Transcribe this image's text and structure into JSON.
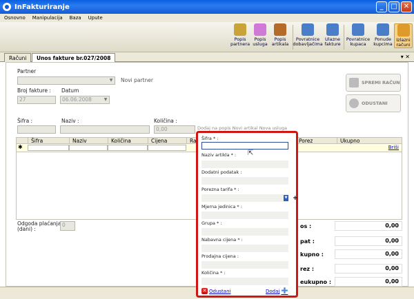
{
  "window": {
    "title": "InFakturiranje"
  },
  "menu": [
    "Osnovno",
    "Manipulacija",
    "Baza",
    "Upute"
  ],
  "toolbar": [
    {
      "label": "Popis\npartnera",
      "icon": "partners-icon",
      "color": "#c9a23a"
    },
    {
      "label": "Popis\nusluga",
      "icon": "services-icon",
      "color": "#d07ad8"
    },
    {
      "label": "Popis\nartikala",
      "icon": "articles-icon",
      "color": "#b66a2a"
    },
    {
      "label": "Povratnice\ndobavljačima",
      "icon": "supplier-return-icon",
      "color": "#4a7ec8"
    },
    {
      "label": "Ulazne\nfakture",
      "icon": "incoming-invoice-icon",
      "color": "#4a7ec8"
    },
    {
      "label": "Povratnice\nkupaca",
      "icon": "customer-return-icon",
      "color": "#4a7ec8"
    },
    {
      "label": "Ponude\nkupcima",
      "icon": "offers-icon",
      "color": "#4a7ec8"
    },
    {
      "label": "Izlazni\nračuni",
      "icon": "outgoing-invoice-icon",
      "color": "#e09a2a"
    }
  ],
  "tabs": {
    "first": "Računi",
    "second": "Unos fakture br.027/2008",
    "controls": "▾ ✕"
  },
  "form": {
    "partner_label": "Partner",
    "new_partner": "Novi partner",
    "invoice_no_label": "Broj fakture :",
    "date_label": "Datum",
    "invoice_no": "27",
    "date": "06.06.2008",
    "code_label": "Šifra :",
    "name_label": "Naziv :",
    "qty_label": "Količina :",
    "qty_value": "0,00",
    "links": "Dodaj na popis   Novi artikal   Nova usluga"
  },
  "buttons": {
    "save": "SPREMI RAČUN",
    "cancel": "ODUSTANI"
  },
  "table": {
    "headers": [
      "Šifra",
      "Naziv",
      "Količina",
      "Cijena",
      "Ra",
      "Porez",
      "Ukupno"
    ],
    "new_row_marker": "✱",
    "delete": "Briši"
  },
  "payment": {
    "label": "Odgoda plaćanja\n(dani) :",
    "value": "0"
  },
  "totals": [
    {
      "label": "os :",
      "value": "0,00"
    },
    {
      "label": "pat :",
      "value": "0,00"
    },
    {
      "label": "kupno :",
      "value": "0,00"
    },
    {
      "label": "rez :",
      "value": "0,00"
    },
    {
      "label": "eukupno :",
      "value": "0,00"
    }
  ],
  "popup": {
    "fields": [
      "Šifra * :",
      "Naziv artikla * :",
      "Dodatni podatak :",
      "Porezna tarifa * :",
      "Mjerna jedinica * :",
      "Grupa * :",
      "Nabavna cijena * :",
      "Prodajna cijena  :",
      "Količina * :"
    ],
    "cancel": "Odustani",
    "add": "Dodaj"
  }
}
